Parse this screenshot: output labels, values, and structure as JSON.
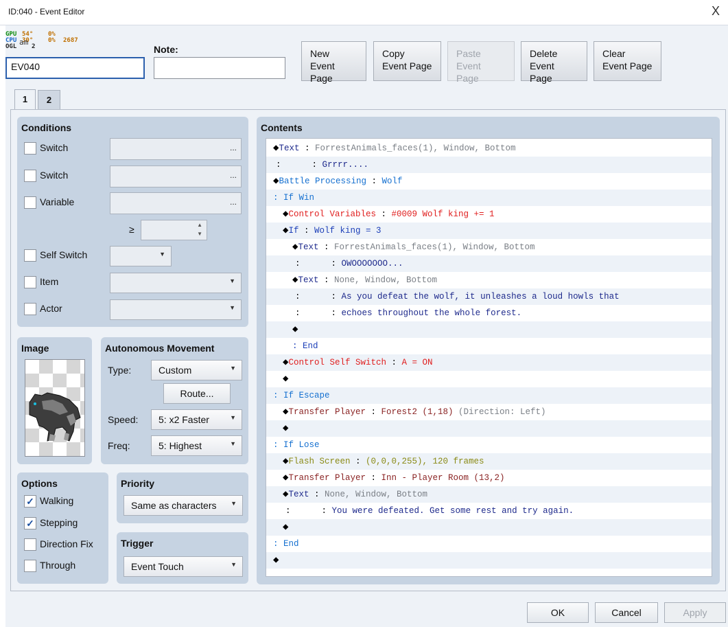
{
  "window": {
    "title": "ID:040 - Event Editor",
    "close_glyph": "X"
  },
  "overlay": {
    "gpu": "GPU",
    "cpu": "CPU",
    "ogl": "OGL",
    "gpu_temp": "54°",
    "cpu_temp": "30°",
    "gpu_load": "0%",
    "cpu_load": "0%",
    "mem": "2687",
    "frames": "2",
    "name_prefix": "am"
  },
  "header": {
    "name_value": "EV040",
    "note_label": "Note:",
    "note_value": "",
    "buttons": [
      {
        "line1": "New",
        "line2": "Event Page",
        "enabled": true
      },
      {
        "line1": "Copy",
        "line2": "Event Page",
        "enabled": true
      },
      {
        "line1": "Paste",
        "line2": "Event Page",
        "enabled": false
      },
      {
        "line1": "Delete",
        "line2": "Event Page",
        "enabled": true
      },
      {
        "line1": "Clear",
        "line2": "Event Page",
        "enabled": true
      }
    ]
  },
  "tabs": [
    "1",
    "2"
  ],
  "conditions": {
    "title": "Conditions",
    "switch1": "Switch",
    "switch2": "Switch",
    "variable": "Variable",
    "gte": "≥",
    "self_switch": "Self Switch",
    "item": "Item",
    "actor": "Actor",
    "dots": "..."
  },
  "image": {
    "title": "Image"
  },
  "autonomous": {
    "title": "Autonomous Movement",
    "type_label": "Type:",
    "type_value": "Custom",
    "route_label": "Route...",
    "speed_label": "Speed:",
    "speed_value": "5: x2 Faster",
    "freq_label": "Freq:",
    "freq_value": "5: Highest"
  },
  "options": {
    "title": "Options",
    "walking": "Walking",
    "stepping": "Stepping",
    "direction_fix": "Direction Fix",
    "through": "Through",
    "check_glyph": "✓"
  },
  "priority": {
    "title": "Priority",
    "value": "Same as characters"
  },
  "trigger": {
    "title": "Trigger",
    "value": "Event Touch"
  },
  "contents": {
    "title": "Contents",
    "diamond": "◆",
    "colon": ":",
    "lines": [
      {
        "cmd": "Text",
        "arg": "ForrestAnimals_faces(1), Window, Bottom"
      },
      {
        "arg": "Grrrr...."
      },
      {
        "cmd": "Battle Processing",
        "arg": "Wolf"
      },
      {
        "branch": "If Win"
      },
      {
        "cmd": "Control Variables",
        "arg": "#0009 Wolf king += 1"
      },
      {
        "cmd": "If",
        "arg": "Wolf king = 3"
      },
      {
        "cmd": "Text",
        "arg": "ForrestAnimals_faces(1), Window, Bottom"
      },
      {
        "arg": "OWOOOOOOO..."
      },
      {
        "cmd": "Text",
        "arg": "None, Window, Bottom"
      },
      {
        "arg": "As you defeat the wolf, it unleashes a loud howls that"
      },
      {
        "arg": "echoes throughout the whole forest."
      },
      {},
      {
        "branch": "End"
      },
      {
        "cmd": "Control Self Switch",
        "arg": "A = ON"
      },
      {},
      {
        "branch": "If Escape"
      },
      {
        "cmd": "Transfer Player",
        "arg": "Forest2 (1,18)",
        "extra": "(Direction: Left)"
      },
      {},
      {
        "branch": "If Lose"
      },
      {
        "cmd": "Flash Screen",
        "arg": "(0,0,0,255), 120 frames"
      },
      {
        "cmd": "Transfer Player",
        "arg": "Inn - Player Room (13,2)"
      },
      {
        "cmd": "Text",
        "arg": "None, Window, Bottom"
      },
      {
        "arg": "You were defeated. Get some rest and try again."
      },
      {},
      {
        "branch": "End"
      },
      {}
    ]
  },
  "footer": {
    "ok": "OK",
    "cancel": "Cancel",
    "apply": "Apply"
  },
  "colors": {
    "panel": "#c6d3e2",
    "window": "#eef2f7",
    "accent": "#2b5fad"
  }
}
